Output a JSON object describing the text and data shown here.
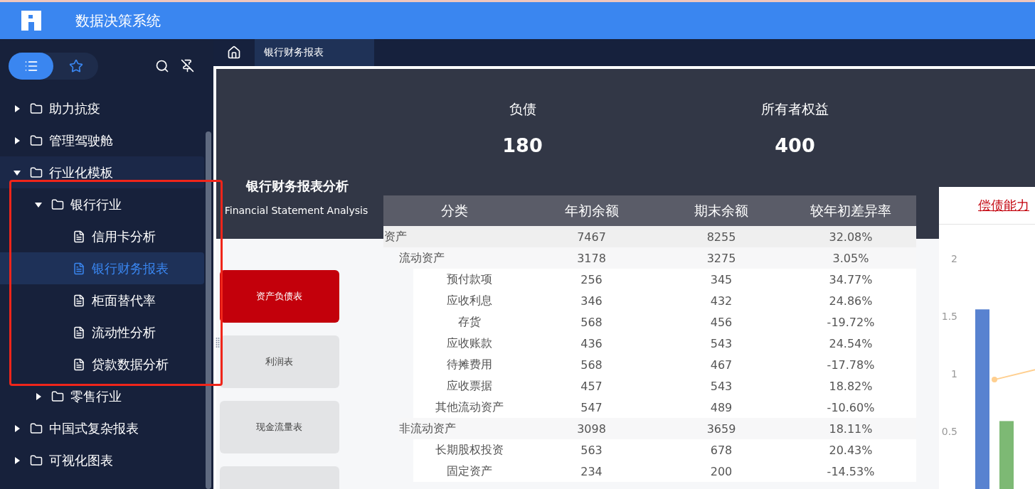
{
  "app": {
    "title": "数据决策系统"
  },
  "sidebar": {
    "view_toggle": [
      {
        "kind": "list",
        "selected": true
      },
      {
        "kind": "star",
        "selected": false
      }
    ],
    "tree": [
      {
        "label": "助力抗疫",
        "kind": "folder",
        "expanded": false,
        "selected": false,
        "hovered": false
      },
      {
        "label": "管理驾驶舱",
        "kind": "folder",
        "expanded": false,
        "selected": false,
        "hovered": false
      },
      {
        "label": "行业化模板",
        "kind": "folder",
        "expanded": true,
        "selected": false,
        "hovered": true,
        "children": [
          {
            "label": "银行行业",
            "kind": "folder",
            "expanded": true,
            "selected": false,
            "hovered": false,
            "children": [
              {
                "label": "信用卡分析",
                "kind": "report",
                "selected": false,
                "hovered": false
              },
              {
                "label": "银行财务报表",
                "kind": "report",
                "selected": true,
                "hovered": false
              },
              {
                "label": "柜面替代率",
                "kind": "report",
                "selected": false,
                "hovered": false
              },
              {
                "label": "流动性分析",
                "kind": "report",
                "selected": false,
                "hovered": false
              },
              {
                "label": "贷款数据分析",
                "kind": "report",
                "selected": false,
                "hovered": false
              }
            ]
          },
          {
            "label": "零售行业",
            "kind": "folder",
            "expanded": false,
            "selected": false,
            "hovered": false
          }
        ]
      },
      {
        "label": "中国式复杂报表",
        "kind": "folder",
        "expanded": false,
        "selected": false,
        "hovered": false
      },
      {
        "label": "可视化图表",
        "kind": "folder",
        "expanded": false,
        "selected": false,
        "hovered": false
      }
    ]
  },
  "tabs": [
    {
      "label": "银行财务报表",
      "selected": true
    }
  ],
  "report": {
    "kpis": [
      {
        "label": "负债",
        "value": "180"
      },
      {
        "label": "所有者权益",
        "value": "400"
      }
    ],
    "title": "银行财务报表分析",
    "subtitle": "Financial Statement Analysis",
    "nav_buttons": [
      {
        "label": "资产负债表",
        "selected": true
      },
      {
        "label": "利润表",
        "selected": false
      },
      {
        "label": "现金流量表",
        "selected": false
      },
      {
        "selected": false
      }
    ],
    "table": {
      "columns": [
        "分类",
        "年初余额",
        "期末余额",
        "较年初差异率"
      ],
      "rows": [
        {
          "cells": [
            "资产",
            "7467",
            "8255",
            "32.08%"
          ],
          "children": [
            {
              "cells": [
                "流动资产",
                "3178",
                "3275",
                "3.05%"
              ],
              "children": [
                {
                  "cells": [
                    "预付款项",
                    "256",
                    "345",
                    "34.77%"
                  ]
                },
                {
                  "cells": [
                    "应收利息",
                    "346",
                    "432",
                    "24.86%"
                  ]
                },
                {
                  "cells": [
                    "存货",
                    "568",
                    "456",
                    "-19.72%"
                  ]
                },
                {
                  "cells": [
                    "应收账款",
                    "436",
                    "543",
                    "24.54%"
                  ]
                },
                {
                  "cells": [
                    "待摊费用",
                    "568",
                    "467",
                    "-17.78%"
                  ]
                },
                {
                  "cells": [
                    "应收票据",
                    "457",
                    "543",
                    "18.82%"
                  ]
                },
                {
                  "cells": [
                    "其他流动资产",
                    "547",
                    "489",
                    "-10.60%"
                  ]
                }
              ]
            },
            {
              "cells": [
                "非流动资产",
                "3098",
                "3659",
                "18.11%"
              ],
              "children": [
                {
                  "cells": [
                    "长期股权投资",
                    "563",
                    "678",
                    "20.43%"
                  ]
                },
                {
                  "cells": [
                    "固定资产",
                    "234",
                    "200",
                    "-14.53%"
                  ]
                }
              ]
            }
          ]
        }
      ]
    },
    "chart": {
      "title": "偿债能力",
      "chart_data": {
        "type": "bar",
        "ylim": [
          0,
          2
        ],
        "yticks": [
          0.5,
          1,
          1.5,
          2
        ],
        "series": [
          {
            "color": "#5882d0",
            "values": [
              1.56
            ]
          },
          {
            "color": "#7db974",
            "values": [
              0.59
            ]
          }
        ]
      }
    }
  }
}
